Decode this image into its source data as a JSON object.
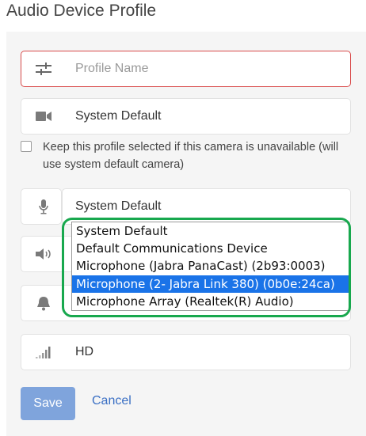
{
  "page": {
    "title": "Audio Device Profile"
  },
  "form": {
    "profile_name": {
      "placeholder": "Profile Name",
      "value": ""
    },
    "camera": {
      "value": "System Default",
      "icon": "video-camera-icon"
    },
    "keep_profile": {
      "checked": false,
      "label": "Keep this profile selected if this camera is unavailable (will use system default camera)"
    },
    "microphone": {
      "value": "System Default",
      "icon": "microphone-icon",
      "options": [
        "System Default",
        "Default Communications Device",
        "Microphone (Jabra PanaCast) (2b93:0003)",
        "Microphone (2- Jabra Link 380) (0b0e:24ca)",
        "Microphone Array (Realtek(R) Audio)"
      ],
      "highlighted_index": 3
    },
    "speaker": {
      "icon": "speaker-icon"
    },
    "ringer": {
      "icon": "bell-icon"
    },
    "quality": {
      "value": "HD",
      "icon": "signal-bars-icon"
    }
  },
  "actions": {
    "save_label": "Save",
    "cancel_label": "Cancel"
  },
  "colors": {
    "error_border": "#d94b4b",
    "selected_option": "#1a73e8",
    "highlight_ring": "#18a84e",
    "save_button": "#7fa4dc",
    "cancel_link": "#3a6fc4"
  }
}
